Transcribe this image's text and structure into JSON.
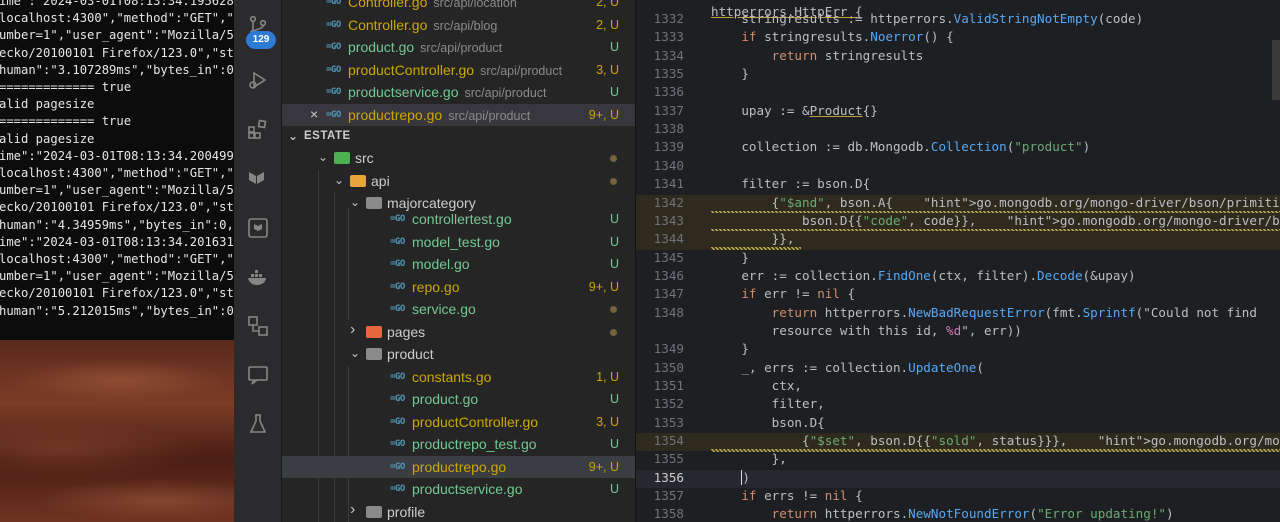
{
  "terminal": {
    "lines": [
      "ime\":\"2024-03-01T08:13:34.195628+",
      "localhost:4300\",\"method\":\"GET\",\"u",
      "umber=1\",\"user_agent\":\"Mozilla/5.",
      "ecko/20100101 Firefox/123.0\",\"sta",
      "human\":\"3.107289ms\",\"bytes_in\":0,",
      "============= true",
      "alid pagesize",
      "============= true",
      "alid pagesize",
      "ime\":\"2024-03-01T08:13:34.200499+",
      "localhost:4300\",\"method\":\"GET\",\"u",
      "umber=1\",\"user_agent\":\"Mozilla/5.",
      "ecko/20100101 Firefox/123.0\",\"sta",
      "human\":\"4.34959ms\",\"bytes_in\":0,",
      "ime\":\"2024-03-01T08:13:34.201631+",
      "localhost:4300\",\"method\":\"GET\",\"u",
      "umber=1\",\"user_agent\":\"Mozilla/5.",
      "ecko/20100101 Firefox/123.0\",\"sta",
      "human\":\"5.212015ms\",\"bytes_in\":0,"
    ]
  },
  "activitybar": {
    "scm_badge": "129"
  },
  "open_editors": [
    {
      "name": "Controller.go",
      "path": "src/api/location",
      "status": "2, U"
    },
    {
      "name": "Controller.go",
      "path": "src/api/blog",
      "status": "2, U"
    },
    {
      "name": "product.go",
      "path": "src/api/product",
      "status": "U"
    },
    {
      "name": "productController.go",
      "path": "src/api/product",
      "status": "3, U"
    },
    {
      "name": "productservice.go",
      "path": "src/api/product",
      "status": "U"
    },
    {
      "name": "productrepo.go",
      "path": "src/api/product",
      "status": "9+, U"
    }
  ],
  "explorer": {
    "section_title": "ESTATE",
    "tree": [
      {
        "label": "src",
        "kind": "folder-open",
        "status": ""
      },
      {
        "label": "api",
        "kind": "folder-open",
        "status": ""
      },
      {
        "label": "majorcategory",
        "kind": "folder-open",
        "status": ""
      },
      {
        "label": "controllertest.go",
        "kind": "file",
        "status": "U"
      },
      {
        "label": "model_test.go",
        "kind": "file",
        "status": "U"
      },
      {
        "label": "model.go",
        "kind": "file",
        "status": "U"
      },
      {
        "label": "repo.go",
        "kind": "file",
        "status": "9+, U"
      },
      {
        "label": "service.go",
        "kind": "file",
        "status": ""
      },
      {
        "label": "pages",
        "kind": "folder-closed",
        "status": ""
      },
      {
        "label": "product",
        "kind": "folder-open",
        "status": ""
      },
      {
        "label": "constants.go",
        "kind": "file",
        "status": "1, U"
      },
      {
        "label": "product.go",
        "kind": "file",
        "status": "U"
      },
      {
        "label": "productController.go",
        "kind": "file",
        "status": "3, U"
      },
      {
        "label": "productrepo_test.go",
        "kind": "file",
        "status": "U"
      },
      {
        "label": "productrepo.go",
        "kind": "file",
        "status": "9+, U"
      },
      {
        "label": "productservice.go",
        "kind": "file",
        "status": "U"
      },
      {
        "label": "profile",
        "kind": "folder-closed",
        "status": ""
      }
    ]
  },
  "editor": {
    "top_partial": "httperrors.HttpErr {",
    "line_numbers": [
      "1332",
      "1333",
      "1334",
      "1335",
      "1336",
      "1337",
      "1338",
      "1339",
      "1340",
      "1341",
      "1342",
      "1343",
      "1344",
      "1345",
      "1346",
      "1347",
      "1348",
      "",
      "1349",
      "1350",
      "1351",
      "1352",
      "1353",
      "1354",
      "1355",
      "1356",
      "1357",
      "1358"
    ],
    "lines": [
      "    stringresults := httperrors.ValidStringNotEmpty(code)",
      "    if stringresults.Noerror() {",
      "        return stringresults",
      "    }",
      "",
      "    upay := &Product{}",
      "",
      "    collection := db.Mongodb.Collection(\"product\")",
      "",
      "    filter := bson.D{",
      "        {\"$and\", bson.A{    go.mongodb.org/mongo-driver/bson/primitive.E stru",
      "            bson.D{{\"code\", code}},    go.mongodb.org/mongo-driver/bson/primi",
      "        }},",
      "    }",
      "    err := collection.FindOne(ctx, filter).Decode(&upay)",
      "    if err != nil {",
      "        return httperrors.NewBadRequestError(fmt.Sprintf(\"Could not find",
      "        resource with this id, %d\", err))",
      "    }",
      "    _, errs := collection.UpdateOne(",
      "        ctx,",
      "        filter,",
      "        bson.D{",
      "            {\"$set\", bson.D{{\"sold\", status}}},    go.mongodb.org/mongo-drive",
      "        },",
      "    )",
      "    if errs != nil {",
      "        return httperrors.NewNotFoundError(\"Error updating!\")"
    ],
    "current_line": "1356"
  }
}
